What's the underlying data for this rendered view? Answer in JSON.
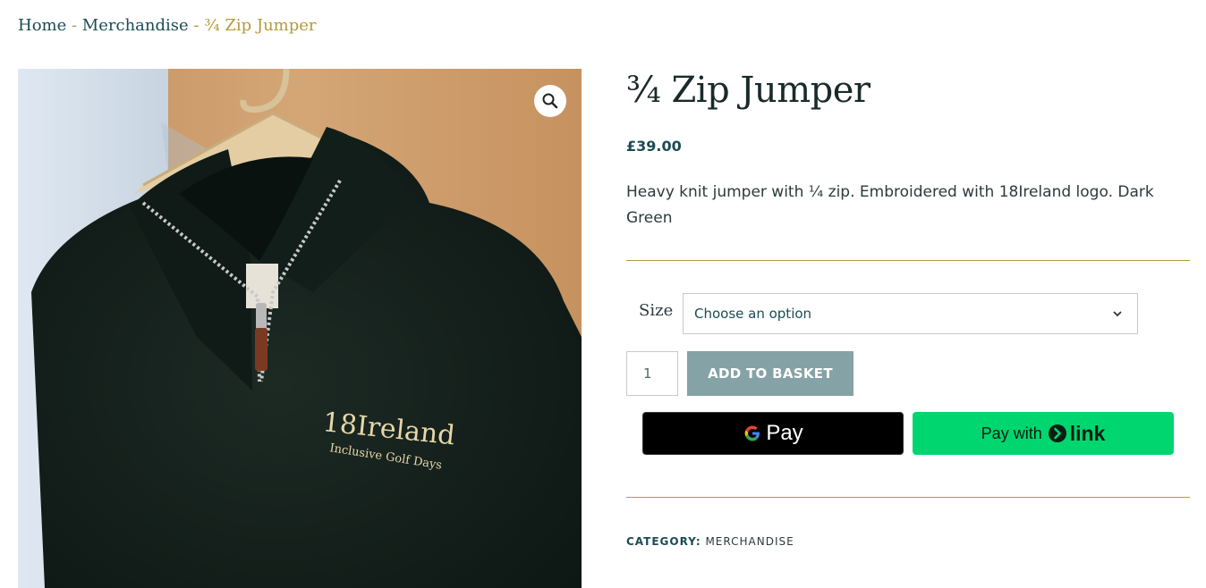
{
  "breadcrumb": {
    "home": "Home",
    "sep1": " - ",
    "category": "Merchandise",
    "sep2": " - ",
    "current": "¾ Zip Jumper"
  },
  "product": {
    "title": "¾ Zip Jumper",
    "price": "£39.00",
    "description": "Heavy knit jumper with ¼ zip. Embroidered with 18Ireland logo. Dark Green",
    "image_logo_text": "18Ireland",
    "image_tagline_text": "Inclusive Golf Days"
  },
  "variations": {
    "size_label": "Size",
    "size_select_value": "Choose an option"
  },
  "cart": {
    "quantity": "1",
    "add_label": "ADD TO BASKET"
  },
  "payments": {
    "gpay_label": "Pay",
    "link_prefix": "Pay with",
    "link_label": "link"
  },
  "meta": {
    "category_key": "CATEGORY:",
    "category_value": "MERCHANDISE"
  },
  "colors": {
    "accent_gold": "#b39a3b",
    "brand_teal": "#1c4b55",
    "add_button": "#85a2a6",
    "link_green": "#00d66f"
  },
  "icons": {
    "zoom": "magnifier-icon",
    "select": "chevron-down-icon",
    "google": "google-g-icon",
    "link": "link-arrow-icon"
  }
}
